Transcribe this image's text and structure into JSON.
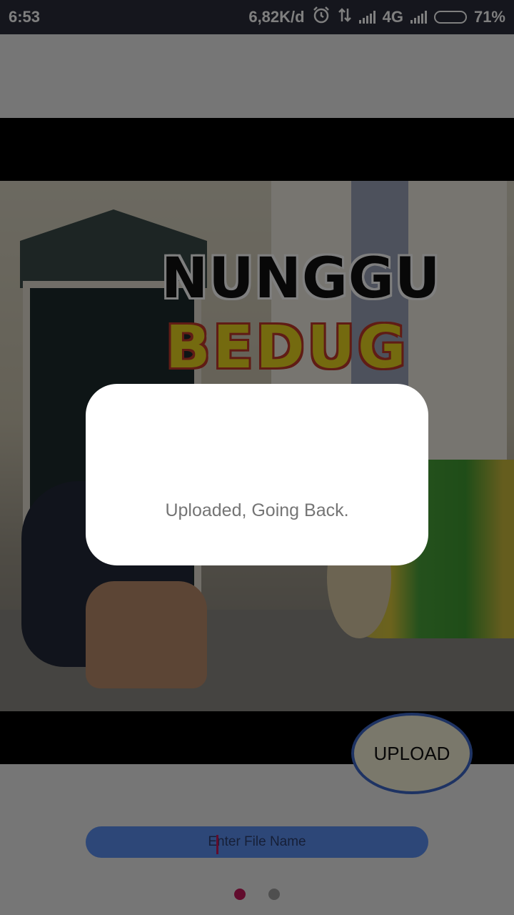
{
  "status_bar": {
    "time": "6:53",
    "network_speed": "6,82K/d",
    "network_type": "4G",
    "battery_percent": "71%",
    "icons": [
      "alarm-icon",
      "data-transfer-icon",
      "signal-icon",
      "signal-icon",
      "battery-icon"
    ]
  },
  "video": {
    "overlay_title": "NUNGGU",
    "overlay_subtitle": "BEDUG"
  },
  "upload_button": {
    "label": "UPLOAD"
  },
  "file_name_input": {
    "placeholder": "Enter File Name",
    "value": ""
  },
  "page_indicator": {
    "count": 2,
    "active_index": 0
  },
  "dialog": {
    "message": "Uploaded, Going Back."
  },
  "colors": {
    "accent": "#c2185b",
    "input_bg": "#5b8ff0",
    "button_border": "#3d66c6",
    "status_bar": "#2b2d3a"
  }
}
